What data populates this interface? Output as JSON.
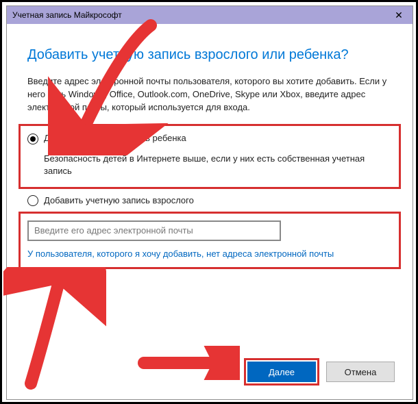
{
  "titlebar": {
    "title": "Учетная запись Майкрософт",
    "close_glyph": "✕"
  },
  "heading": "Добавить учетную запись взрослого или ребенка?",
  "description": "Введите адрес электронной почты пользователя, которого вы хотите добавить. Если у него есть Windows, Office, Outlook.com, OneDrive, Skype или Xbox, введите адрес электронной почты, который используется для входа.",
  "radio_child": {
    "label": "Добавить учетную запись ребенка",
    "sub": "Безопасность детей в Интернете выше, если у них есть собственная учетная запись"
  },
  "radio_adult": {
    "label": "Добавить учетную запись взрослого"
  },
  "email": {
    "placeholder": "Введите его адрес электронной почты"
  },
  "no_email_link": "У пользователя, которого я хочу добавить, нет адреса электронной почты",
  "buttons": {
    "next": "Далее",
    "cancel": "Отмена"
  },
  "colors": {
    "accent": "#0067c0",
    "highlight_border": "#d62f2f",
    "arrow": "#e63434",
    "titlebar": "#a9a4d8"
  }
}
